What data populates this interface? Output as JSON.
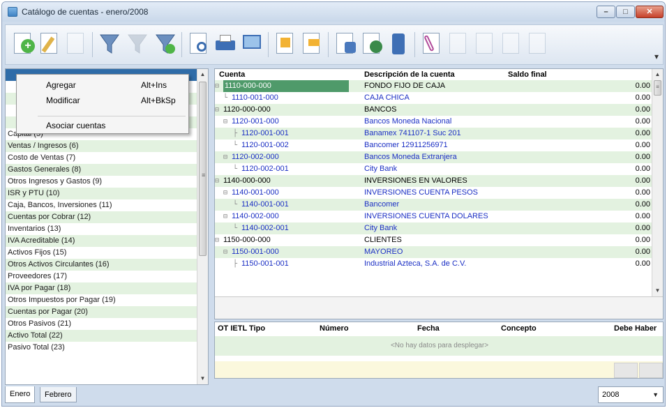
{
  "window": {
    "title": "Catálogo de cuentas - enero/2008"
  },
  "toolbar": {
    "buttons": [
      "add-account-icon",
      "edit-account-icon",
      "disabled-icon",
      "filter-icon",
      "disabled-filter-icon",
      "clear-filter-icon",
      "print-preview-icon",
      "print-icon",
      "screen-report-icon",
      "export-icon",
      "import-icon",
      "copy-icon",
      "connect-icon",
      "device-icon",
      "clip-icon",
      "disabled-icon",
      "disabled-icon",
      "disabled-icon",
      "disabled-icon"
    ]
  },
  "context_menu": {
    "items": [
      {
        "label": "Agregar",
        "shortcut": "Alt+Ins"
      },
      {
        "label": "Modificar",
        "shortcut": "Alt+BkSp"
      },
      {
        "label": "Asociar cuentas",
        "shortcut": ""
      }
    ]
  },
  "left_list": [
    "",
    "",
    "",
    "",
    "",
    "Capital (5)",
    "Ventas / Ingresos (6)",
    "Costo de Ventas (7)",
    "Gastos Generales (8)",
    "Otros Ingresos y Gastos (9)",
    "ISR y PTU (10)",
    "Caja, Bancos, Inversiones (11)",
    "Cuentas por Cobrar (12)",
    "Inventarios (13)",
    "IVA Acreditable (14)",
    "Activos Fijos (15)",
    "Otros Activos Circulantes (16)",
    "Proveedores (17)",
    "IVA por Pagar (18)",
    "Otros Impuestos por Pagar (19)",
    "Cuentas por Pagar (20)",
    "Otros Pasivos (21)",
    "Activo Total (22)",
    "Pasivo Total (23)"
  ],
  "grid": {
    "headers": {
      "account": "Cuenta",
      "description": "Descripción de la cuenta",
      "balance": "Saldo final"
    },
    "rows": [
      {
        "account": "1110-000-000",
        "description": "FONDO FIJO DE CAJA",
        "balance": "0.00",
        "level": 0,
        "prefix": "⊟",
        "blue": false
      },
      {
        "account": "1110-001-000",
        "description": "CAJA CHICA",
        "balance": "0.00",
        "level": 1,
        "prefix": "└",
        "blue": true
      },
      {
        "account": "1120-000-000",
        "description": "BANCOS",
        "balance": "0.00",
        "level": 0,
        "prefix": "⊟",
        "blue": false
      },
      {
        "account": "1120-001-000",
        "description": "Bancos Moneda Nacional",
        "balance": "0.00",
        "level": 1,
        "prefix": "⊟",
        "blue": true
      },
      {
        "account": "1120-001-001",
        "description": "Banamex 741107-1 Suc 201",
        "balance": "0.00",
        "level": 2,
        "prefix": "├",
        "blue": true
      },
      {
        "account": "1120-001-002",
        "description": "Bancomer 12911256971",
        "balance": "0.00",
        "level": 2,
        "prefix": "└",
        "blue": true
      },
      {
        "account": "1120-002-000",
        "description": "Bancos Moneda Extranjera",
        "balance": "0.00",
        "level": 1,
        "prefix": "⊟",
        "blue": true
      },
      {
        "account": "1120-002-001",
        "description": "City Bank",
        "balance": "0.00",
        "level": 2,
        "prefix": "└",
        "blue": true
      },
      {
        "account": "1140-000-000",
        "description": "INVERSIONES EN VALORES",
        "balance": "0.00",
        "level": 0,
        "prefix": "⊟",
        "blue": false
      },
      {
        "account": "1140-001-000",
        "description": "INVERSIONES CUENTA PESOS",
        "balance": "0.00",
        "level": 1,
        "prefix": "⊟",
        "blue": true
      },
      {
        "account": "1140-001-001",
        "description": "Bancomer",
        "balance": "0.00",
        "level": 2,
        "prefix": "└",
        "blue": true
      },
      {
        "account": "1140-002-000",
        "description": "INVERSIONES CUENTA DOLARES",
        "balance": "0.00",
        "level": 1,
        "prefix": "⊟",
        "blue": true
      },
      {
        "account": "1140-002-001",
        "description": "City Bank",
        "balance": "0.00",
        "level": 2,
        "prefix": "└",
        "blue": true
      },
      {
        "account": "1150-000-000",
        "description": "CLIENTES",
        "balance": "0.00",
        "level": 0,
        "prefix": "⊟",
        "blue": false
      },
      {
        "account": "1150-001-000",
        "description": "MAYOREO",
        "balance": "0.00",
        "level": 1,
        "prefix": "⊟",
        "blue": true
      },
      {
        "account": "1150-001-001",
        "description": "Industrial Azteca, S.A. de C.V.",
        "balance": "0.00",
        "level": 2,
        "prefix": "├",
        "blue": true
      }
    ]
  },
  "detail": {
    "headers": [
      "OT IETL Tipo",
      "Número",
      "Fecha",
      "Concepto",
      "Debe Haber"
    ],
    "empty_text": "<No hay datos para desplegar>"
  },
  "tabs": [
    "Enero",
    "Febrero"
  ],
  "year": "2008",
  "colors": {
    "row_alt": "#e3f2e0",
    "selected_account": "#4f9a6a",
    "link_blue": "#1b2fc4"
  }
}
